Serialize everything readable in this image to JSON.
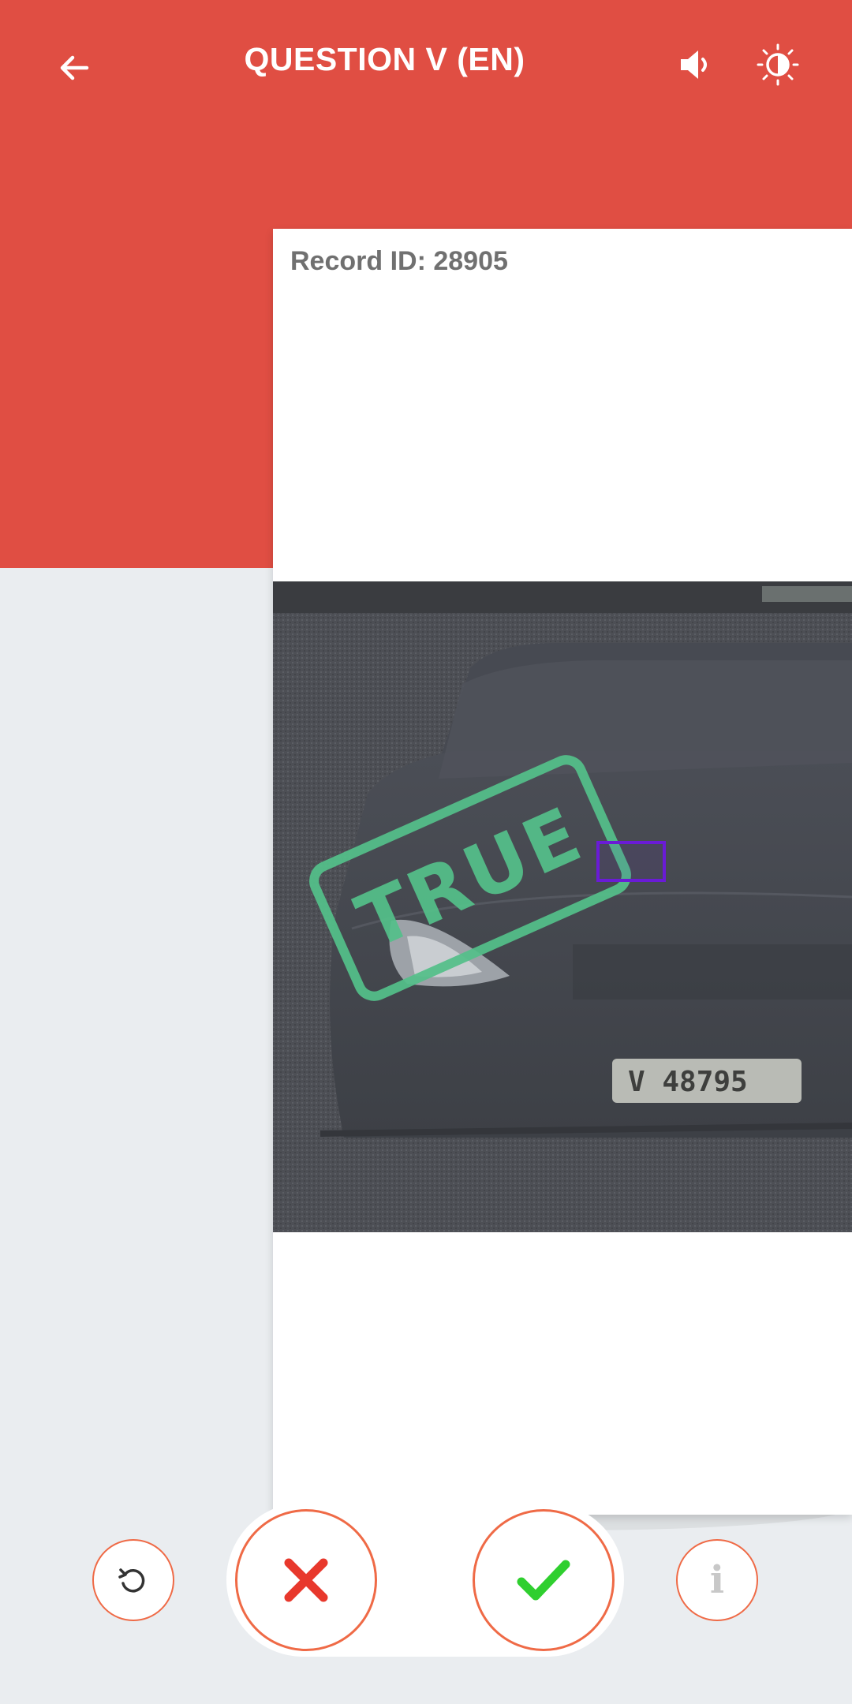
{
  "header": {
    "title": "QUESTION V (EN)",
    "back_icon": "arrow-left-icon",
    "sound_icon": "volume-icon",
    "brightness_icon": "brightness-icon"
  },
  "card": {
    "record_id": "Record ID: 28905",
    "photo": {
      "description_icon": "car-photo",
      "plate_text": "V 48795",
      "stamp_text": "TRUE"
    }
  },
  "controls": {
    "undo_icon": "undo-icon",
    "reject_icon": "close-icon",
    "accept_icon": "check-icon",
    "info_label": "i"
  },
  "colors": {
    "header_red": "#e04e43",
    "stamp_green": "#54c08a",
    "bbox_purple": "#6a1bd6",
    "reject_red": "#e8382c",
    "accept_green": "#2fcf2f",
    "button_outline": "#ef6a46"
  }
}
